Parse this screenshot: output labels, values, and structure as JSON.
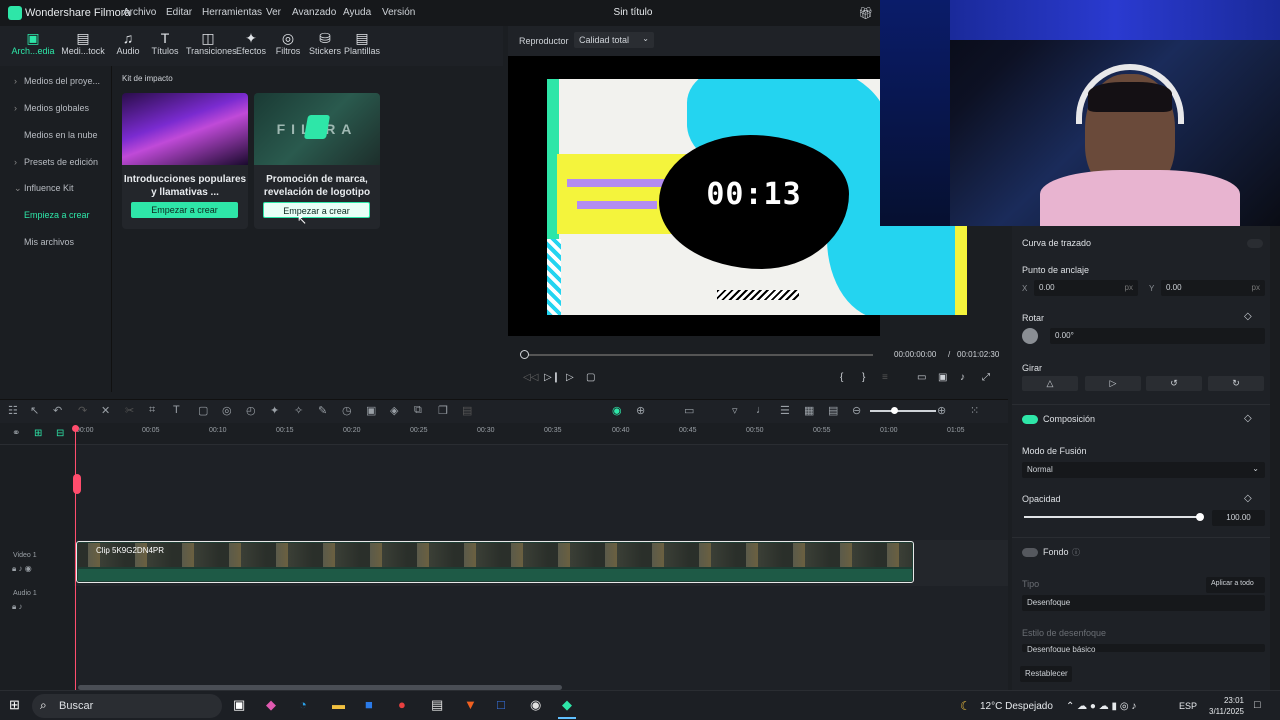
{
  "app": {
    "name": "Wondershare Filmora",
    "doc_title": "Sin título"
  },
  "menu": [
    "Archivo",
    "Editar",
    "Herramientas",
    "Ver",
    "Avanzado",
    "Ayuda",
    "Versión"
  ],
  "tabs": [
    {
      "label": "Arch...edia",
      "icon": "media-icon"
    },
    {
      "label": "Medi...tock",
      "icon": "stock-icon"
    },
    {
      "label": "Audio",
      "icon": "audio-icon"
    },
    {
      "label": "Títulos",
      "icon": "titles-icon"
    },
    {
      "label": "Transiciones",
      "icon": "transitions-icon"
    },
    {
      "label": "Efectos",
      "icon": "effects-icon"
    },
    {
      "label": "Filtros",
      "icon": "filters-icon"
    },
    {
      "label": "Stickers",
      "icon": "stickers-icon"
    },
    {
      "label": "Plantillas",
      "icon": "templates-icon"
    }
  ],
  "sidebar": [
    {
      "label": "Medios del proye..."
    },
    {
      "label": "Medios globales"
    },
    {
      "label": "Medios en la nube"
    },
    {
      "label": "Presets de edición"
    },
    {
      "label": "Influence Kit"
    },
    {
      "label": "Empieza a crear"
    },
    {
      "label": "Mis archivos"
    }
  ],
  "kit": {
    "section_title": "Kit de impacto",
    "cards": [
      {
        "title1": "Introducciones populares",
        "title2": "y llamativas ...",
        "button": "Empezar a crear"
      },
      {
        "title1": "Promoción de marca,",
        "title2": "revelación de logotipo",
        "button": "Empezar a crear",
        "thumb_text": "FIL    RA"
      }
    ]
  },
  "player": {
    "label": "Reproductor",
    "quality": "Calidad total",
    "preview_timer": "00:13",
    "current_time": "00:00:00:00",
    "separator": "/",
    "total_time": "00:01:02:30",
    "progress": 0.0
  },
  "timeline": {
    "ruler": [
      "00:00",
      "00:05",
      "00:10",
      "00:15",
      "00:20",
      "00:25",
      "00:30",
      "00:35",
      "00:40",
      "00:45",
      "00:50",
      "00:55",
      "01:00",
      "01:05"
    ],
    "video_track_label": "Video 1",
    "audio_track_label": "Audio 1",
    "clip_name": "Clip 5K9G2DN4PR"
  },
  "properties": {
    "curva": "Curva de trazado",
    "anchor": "Punto de anclaje",
    "anchor_x_label": "X",
    "anchor_x": "0.00",
    "anchor_x_unit": "px",
    "anchor_y_label": "Y",
    "anchor_y": "0.00",
    "anchor_y_unit": "px",
    "rotate": "Rotar",
    "rotate_value": "0.00°",
    "flip": "Girar",
    "composition": "Composición",
    "blend_mode_label": "Modo de Fusión",
    "blend_mode": "Normal",
    "opacity_label": "Opacidad",
    "opacity": "100.00",
    "opacity_level": 1.0,
    "background": "Fondo",
    "type_label": "Tipo",
    "apply_all": "Aplicar a todo",
    "type_value": "Desenfoque",
    "blur_style_label": "Estilo de desenfoque",
    "blur_style_value": "Desenfoque básico",
    "reset": "Restablecer"
  },
  "taskbar": {
    "search": "Buscar",
    "weather": "12°C  Despejado",
    "lang": "ESP",
    "time": "23:01",
    "date": "3/11/2025"
  },
  "colors": {
    "accent": "#2ee6a8",
    "playhead": "#ff4d6d"
  }
}
